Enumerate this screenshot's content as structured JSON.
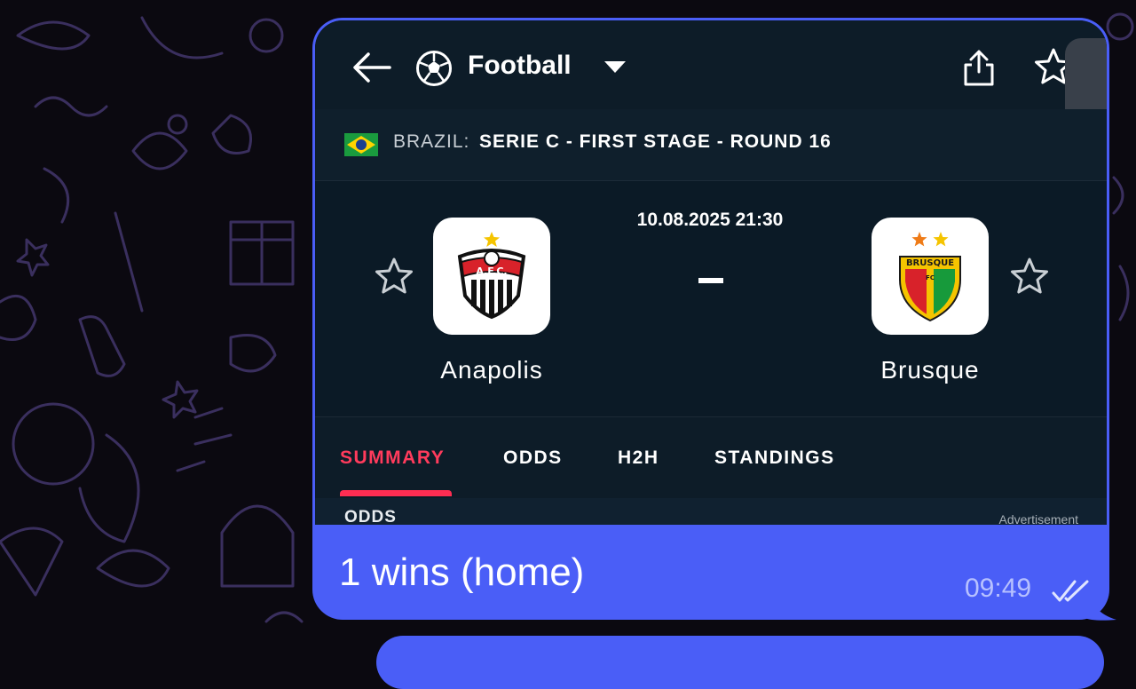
{
  "app": {
    "sport_title": "Football"
  },
  "league": {
    "country": "BRAZIL:",
    "name": "SERIE C - FIRST STAGE - ROUND 16"
  },
  "match": {
    "datetime": "10.08.2025 21:30",
    "score": "-",
    "home": {
      "name": "Anapolis",
      "badge_text": "A.F.C.",
      "badge_stars": 1
    },
    "away": {
      "name": "Brusque",
      "badge_text": "BRUSQUE",
      "badge_sub": "FC",
      "badge_year": "1987",
      "badge_stars": 2
    }
  },
  "tabs": [
    {
      "label": "SUMMARY",
      "active": true
    },
    {
      "label": "ODDS",
      "active": false
    },
    {
      "label": "H2H",
      "active": false
    },
    {
      "label": "STANDINGS",
      "active": false
    }
  ],
  "section": {
    "title": "ODDS",
    "ad_label": "Advertisement"
  },
  "message": {
    "text": "1 wins (home)",
    "time": "09:49",
    "status_icon": "double-check-icon"
  },
  "colors": {
    "accent": "#ff2d52",
    "bubble": "#4a5ef7",
    "background": "#0b0910",
    "panel": "#0b1a26"
  }
}
